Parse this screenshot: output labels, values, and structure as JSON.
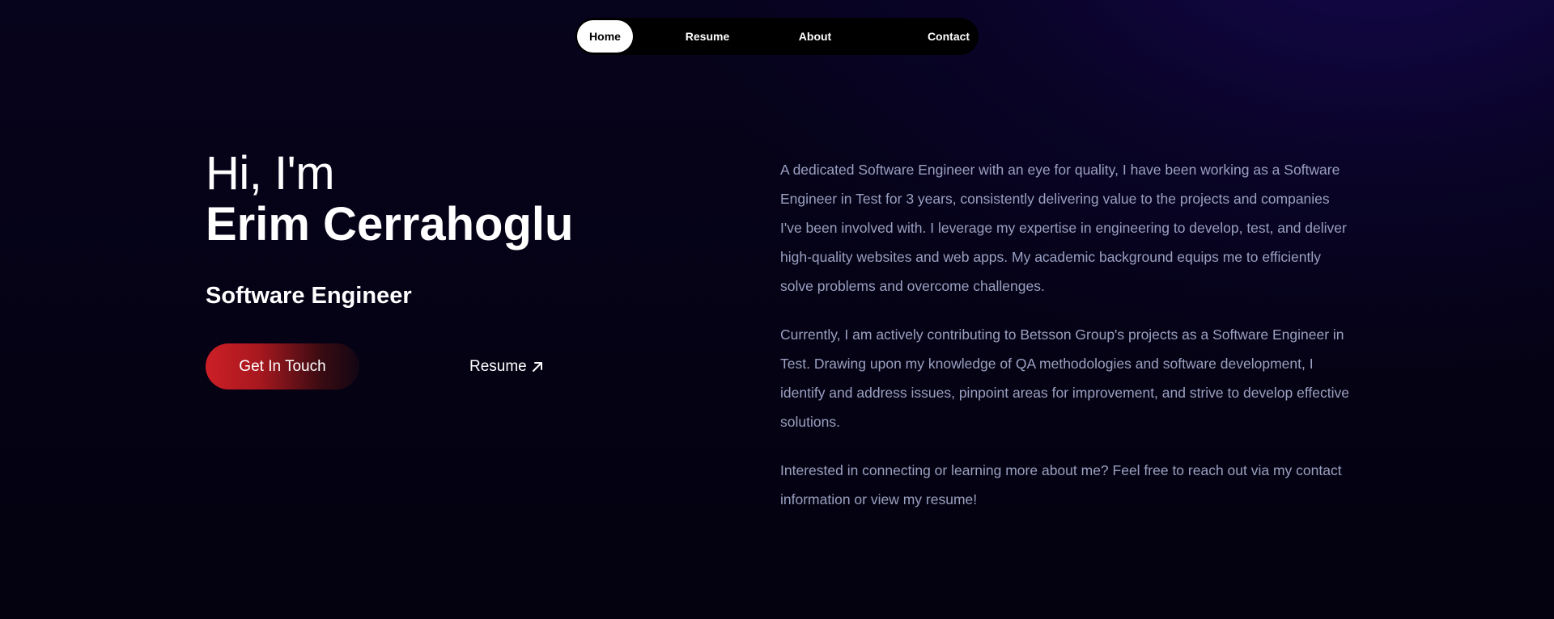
{
  "nav": {
    "items": [
      {
        "label": "Home",
        "active": true
      },
      {
        "label": "Resume",
        "active": false
      },
      {
        "label": "About",
        "active": false
      },
      {
        "label": "Contact",
        "active": false
      }
    ]
  },
  "hero": {
    "greeting": "Hi, I'm",
    "name": "Erim Cerrahoglu",
    "role": "Software Engineer",
    "cta_label": "Get In Touch",
    "resume_label": "Resume",
    "resume_icon": "arrow-up-right-icon",
    "cta_gradient": [
      "#cd1f26",
      "#120614"
    ]
  },
  "bio": {
    "paragraphs": [
      "A dedicated Software Engineer with an eye for quality, I have been working as a Software Engineer in Test for 3 years, consistently delivering value to the projects and companies I've been involved with. I leverage my expertise in engineering to develop, test, and deliver high-quality websites and web apps. My academic background equips me to efficiently solve problems and overcome challenges.",
      "Currently, I am actively contributing to Betsson Group's projects as a Software Engineer in Test. Drawing upon my knowledge of QA methodologies and software development, I identify and address issues, pinpoint areas for improvement, and strive to develop effective solutions.",
      "Interested in connecting or learning more about me? Feel free to reach out via my contact information or view my resume!"
    ]
  },
  "colors": {
    "background": "#05031a",
    "accent": "#cd1f26",
    "bio_text": "#9aa0c0"
  }
}
